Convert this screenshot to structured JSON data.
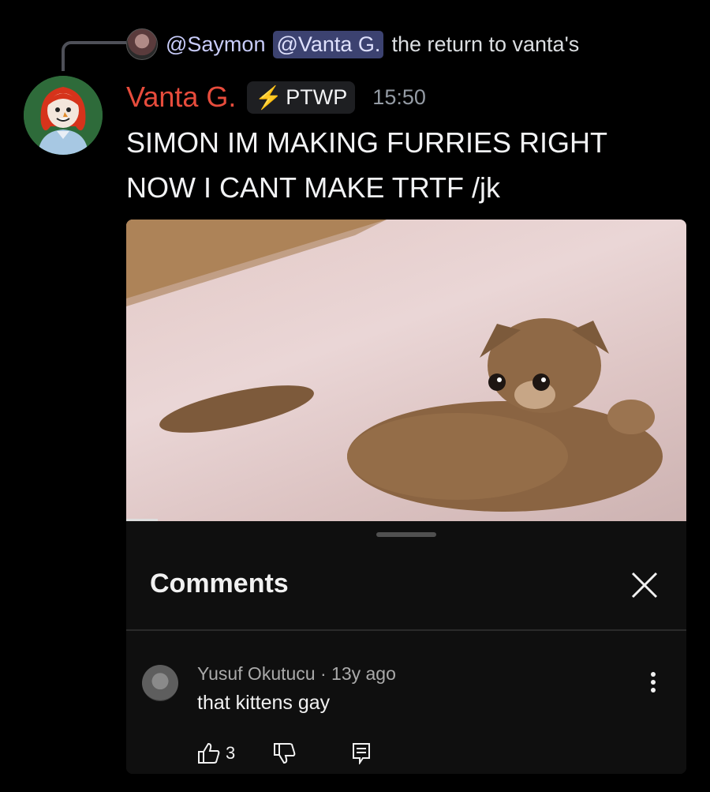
{
  "reply": {
    "mention1": "@Saymon",
    "mention2": "@Vanta G.",
    "text": "the return to vanta's"
  },
  "message": {
    "username": "Vanta G.",
    "username_color": "#e74c3c",
    "tag": "PTWP",
    "tag_icon": "lightning-bolt-icon",
    "time": "15:50",
    "line1": "SIMON IM MAKING FURRIES RIGHT",
    "line2": "NOW I CANT MAKE TRTF /jk"
  },
  "embed": {
    "video_description": "kitten",
    "comments_title": "Comments",
    "comment": {
      "author": "Yusuf Okutucu",
      "age": "13y ago",
      "text": "that kittens gay",
      "likes": "3"
    }
  }
}
